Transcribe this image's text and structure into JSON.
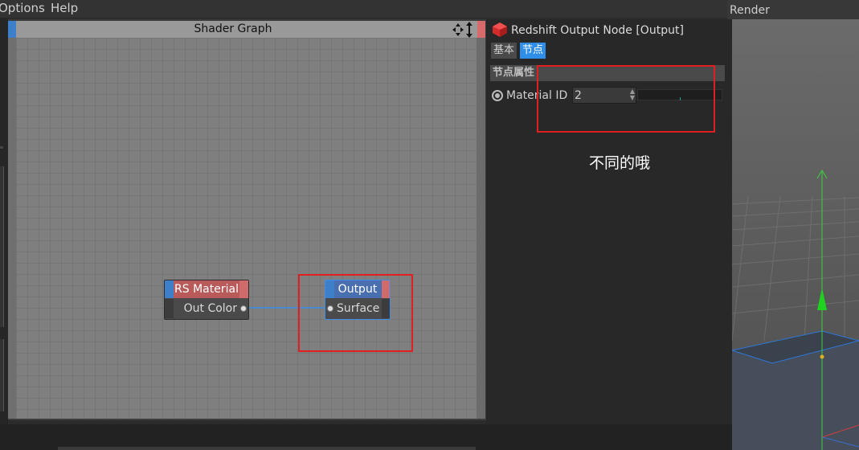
{
  "menu": {
    "items": [
      "Options",
      "Help"
    ]
  },
  "shader_graph": {
    "title": "Shader Graph",
    "nodes": {
      "rs_material": {
        "title": "RS Material",
        "port_label": "Out Color"
      },
      "output": {
        "title": "Output",
        "port_label": "Surface"
      }
    }
  },
  "attributes": {
    "title": "Redshift Output Node [Output]",
    "tabs": [
      {
        "label": "基本",
        "active": false
      },
      {
        "label": "节点",
        "active": true
      }
    ],
    "section_label": "节点属性",
    "material_id": {
      "label": "Material ID",
      "value": "2"
    }
  },
  "annotation": "不同的哦",
  "viewport": {
    "label": "Render"
  },
  "colors": {
    "accent_blue": "#2f8ee8",
    "highlight_red": "#e02020",
    "node_material_head": "#b85a5a",
    "node_output_head": "#4a6fb0"
  }
}
